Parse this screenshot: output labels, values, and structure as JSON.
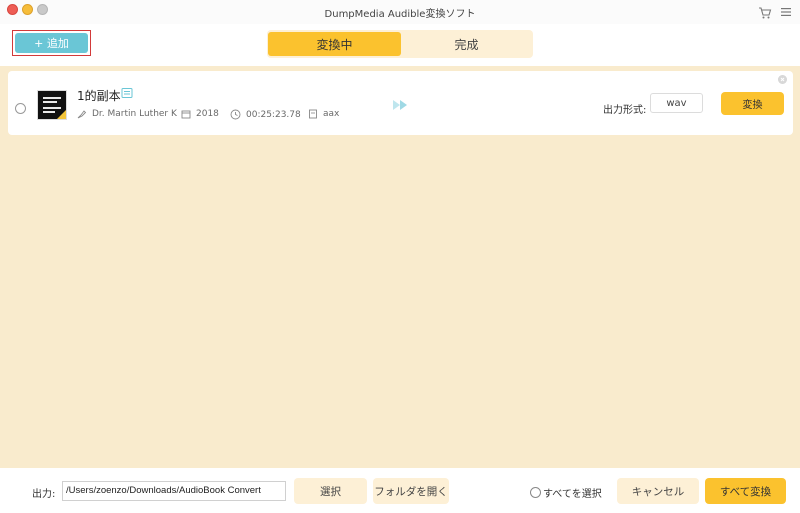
{
  "window": {
    "title": "DumpMedia Audible変換ソフト"
  },
  "toolbar": {
    "add_label": "+ 追加"
  },
  "tabs": [
    {
      "label": "変換中",
      "active": true
    },
    {
      "label": "完成",
      "active": false
    }
  ],
  "items": [
    {
      "title": "1的副本",
      "author": "Dr. Martin Luther K",
      "year": "2018",
      "duration": "00:25:23.78",
      "source_format": "aax",
      "output_format_label": "出力形式:",
      "output_format": "wav",
      "convert_label": "変換"
    }
  ],
  "bottom": {
    "output_label": "出力:",
    "output_path": "/Users/zoenzo/Downloads/AudioBook Convert",
    "select_label": "選択",
    "open_folder_label": "フォルダを開く",
    "select_all_label": "すべてを選択",
    "cancel_label": "キャンセル",
    "convert_all_label": "すべて変換"
  },
  "colors": {
    "accent": "#fbc22e",
    "add_button": "#6ac6d6",
    "main_bg": "#f9ebcd",
    "soft_button": "#fdf0d6"
  },
  "icons": {
    "cart": "cart-icon",
    "menu": "menu-icon",
    "document": "document-icon",
    "author": "author-icon",
    "calendar": "calendar-icon",
    "clock": "clock-icon",
    "file": "file-icon",
    "arrow": "play-arrow-icon",
    "remove": "remove-icon"
  }
}
